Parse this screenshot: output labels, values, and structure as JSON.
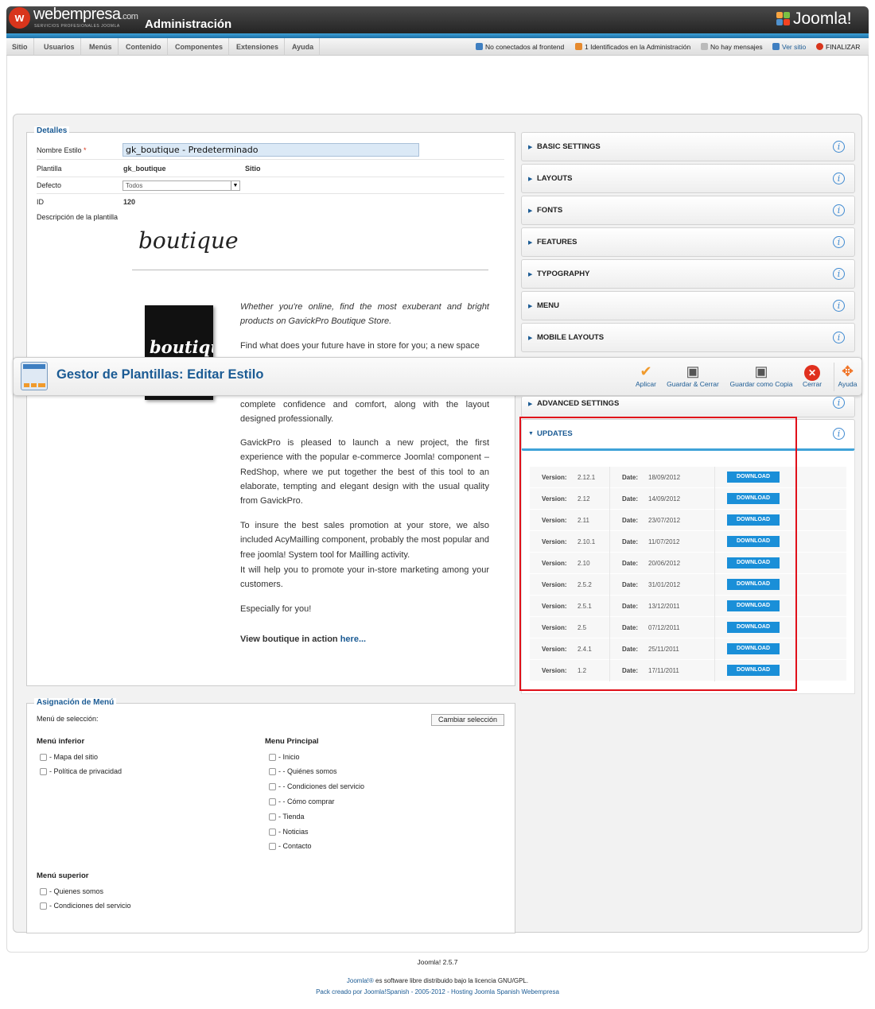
{
  "header": {
    "brand": "webempresa",
    "brand_domain": ".com",
    "brand_tagline": "SERVICIOS PROFESIONALES JOOMLA",
    "title": "Administración",
    "product_logo": "Joomla!"
  },
  "menubar": {
    "items": [
      "Sitio",
      "Usuarios",
      "Menús",
      "Contenido",
      "Componentes",
      "Extensiones",
      "Ayuda"
    ],
    "status": {
      "frontend": "No conectados al frontend",
      "admin": "1 Identificados en la Administración",
      "messages": "No hay mensajes",
      "view_site": "Ver sitio",
      "logout": "FINALIZAR"
    }
  },
  "toolbar": {
    "title": "Gestor de Plantillas: Editar Estilo",
    "buttons": {
      "apply": "Aplicar",
      "save_close": "Guardar & Cerrar",
      "save_copy": "Guardar como Copia",
      "close": "Cerrar",
      "help": "Ayuda"
    }
  },
  "details": {
    "legend": "Detalles",
    "style_name_label": "Nombre Estilo",
    "required_mark": "*",
    "style_name_value": "gk_boutique - Predeterminado",
    "template_label": "Plantilla",
    "template_value": "gk_boutique",
    "client_value": "Sitio",
    "default_label": "Defecto",
    "default_value": "Todos",
    "id_label": "ID",
    "id_value": "120",
    "description_label": "Descripción de la plantilla",
    "boutique_title": "boutique",
    "image_text": "boutique",
    "paragraphs": [
      "Whether you're online, find the most exuberant and bright products on GavickPro Boutique Store.",
      "Find what does your future have in store for you; a new space",
      "complete confidence and comfort, along with the layout designed professionally.",
      "GavickPro is pleased to launch a new project, the first experience with the popular e-commerce Joomla! component – RedShop, where we put together the best of this tool to an elaborate, tempting and elegant design with the usual quality from GavickPro.",
      "To insure the best sales promotion at your store, we also included AcyMailling component, probably the most popular and free joomla! System tool for Mailling activity.",
      "It will help you to promote your in-store marketing among your customers.",
      "Especially for you!"
    ],
    "view_text": "View boutique in action",
    "view_link": "here..."
  },
  "menu_assignment": {
    "legend": "Asignación de Menú",
    "selection_label": "Menú de selección:",
    "change_button": "Cambiar selección",
    "menu_inferior": {
      "title": "Menú inferior",
      "items": [
        "- Mapa del sitio",
        "- Política de privacidad"
      ]
    },
    "menu_principal": {
      "title": "Menu Principal",
      "items": [
        "- Inicio",
        "- - Quiénes somos",
        "- - Condiciones del servicio",
        "- - Cómo comprar",
        "- Tienda",
        "- Noticias",
        "- Contacto"
      ]
    },
    "menu_superior": {
      "title": "Menú superior",
      "items": [
        "- Quienes somos",
        "- Condiciones del servicio"
      ]
    }
  },
  "panels": {
    "sections": [
      "BASIC SETTINGS",
      "LAYOUTS",
      "FONTS",
      "FEATURES",
      "TYPOGRAPHY",
      "MENU",
      "MOBILE LAYOUTS",
      "ADVANCED SETTINGS"
    ],
    "updates": {
      "title": "UPDATES",
      "version_label": "Version:",
      "date_label": "Date:",
      "download_label": "DOWNLOAD",
      "rows": [
        {
          "version": "2.12.1",
          "date": "18/09/2012"
        },
        {
          "version": "2.12",
          "date": "14/09/2012"
        },
        {
          "version": "2.11",
          "date": "23/07/2012"
        },
        {
          "version": "2.10.1",
          "date": "11/07/2012"
        },
        {
          "version": "2.10",
          "date": "20/06/2012"
        },
        {
          "version": "2.5.2",
          "date": "31/01/2012"
        },
        {
          "version": "2.5.1",
          "date": "13/12/2011"
        },
        {
          "version": "2.5",
          "date": "07/12/2011"
        },
        {
          "version": "2.4.1",
          "date": "25/11/2011"
        },
        {
          "version": "1.2",
          "date": "17/11/2011"
        }
      ]
    }
  },
  "footer": {
    "version": "Joomla! 2.5.7",
    "license_link": "Joomla!®",
    "license_text": " es software libre distribuido bajo la licencia GNU/GPL.",
    "pack": "Pack creado por Joomla!Spanish - 2005-2012 - Hosting Joomla Spanish Webempresa"
  },
  "colors": {
    "accent": "#1b5b94",
    "highlight_box": "#e0101a",
    "download_button": "#1a8fd8",
    "header_stripe": "#3fa2d8"
  },
  "icons": [
    "user-icon",
    "admin-users-icon",
    "message-icon",
    "view-site-icon",
    "logout-icon",
    "apply-checkmark-icon",
    "save-close-icon",
    "save-copy-icon",
    "close-icon",
    "help-icon",
    "info-icon",
    "expand-arrow-icon",
    "template-manager-icon"
  ]
}
